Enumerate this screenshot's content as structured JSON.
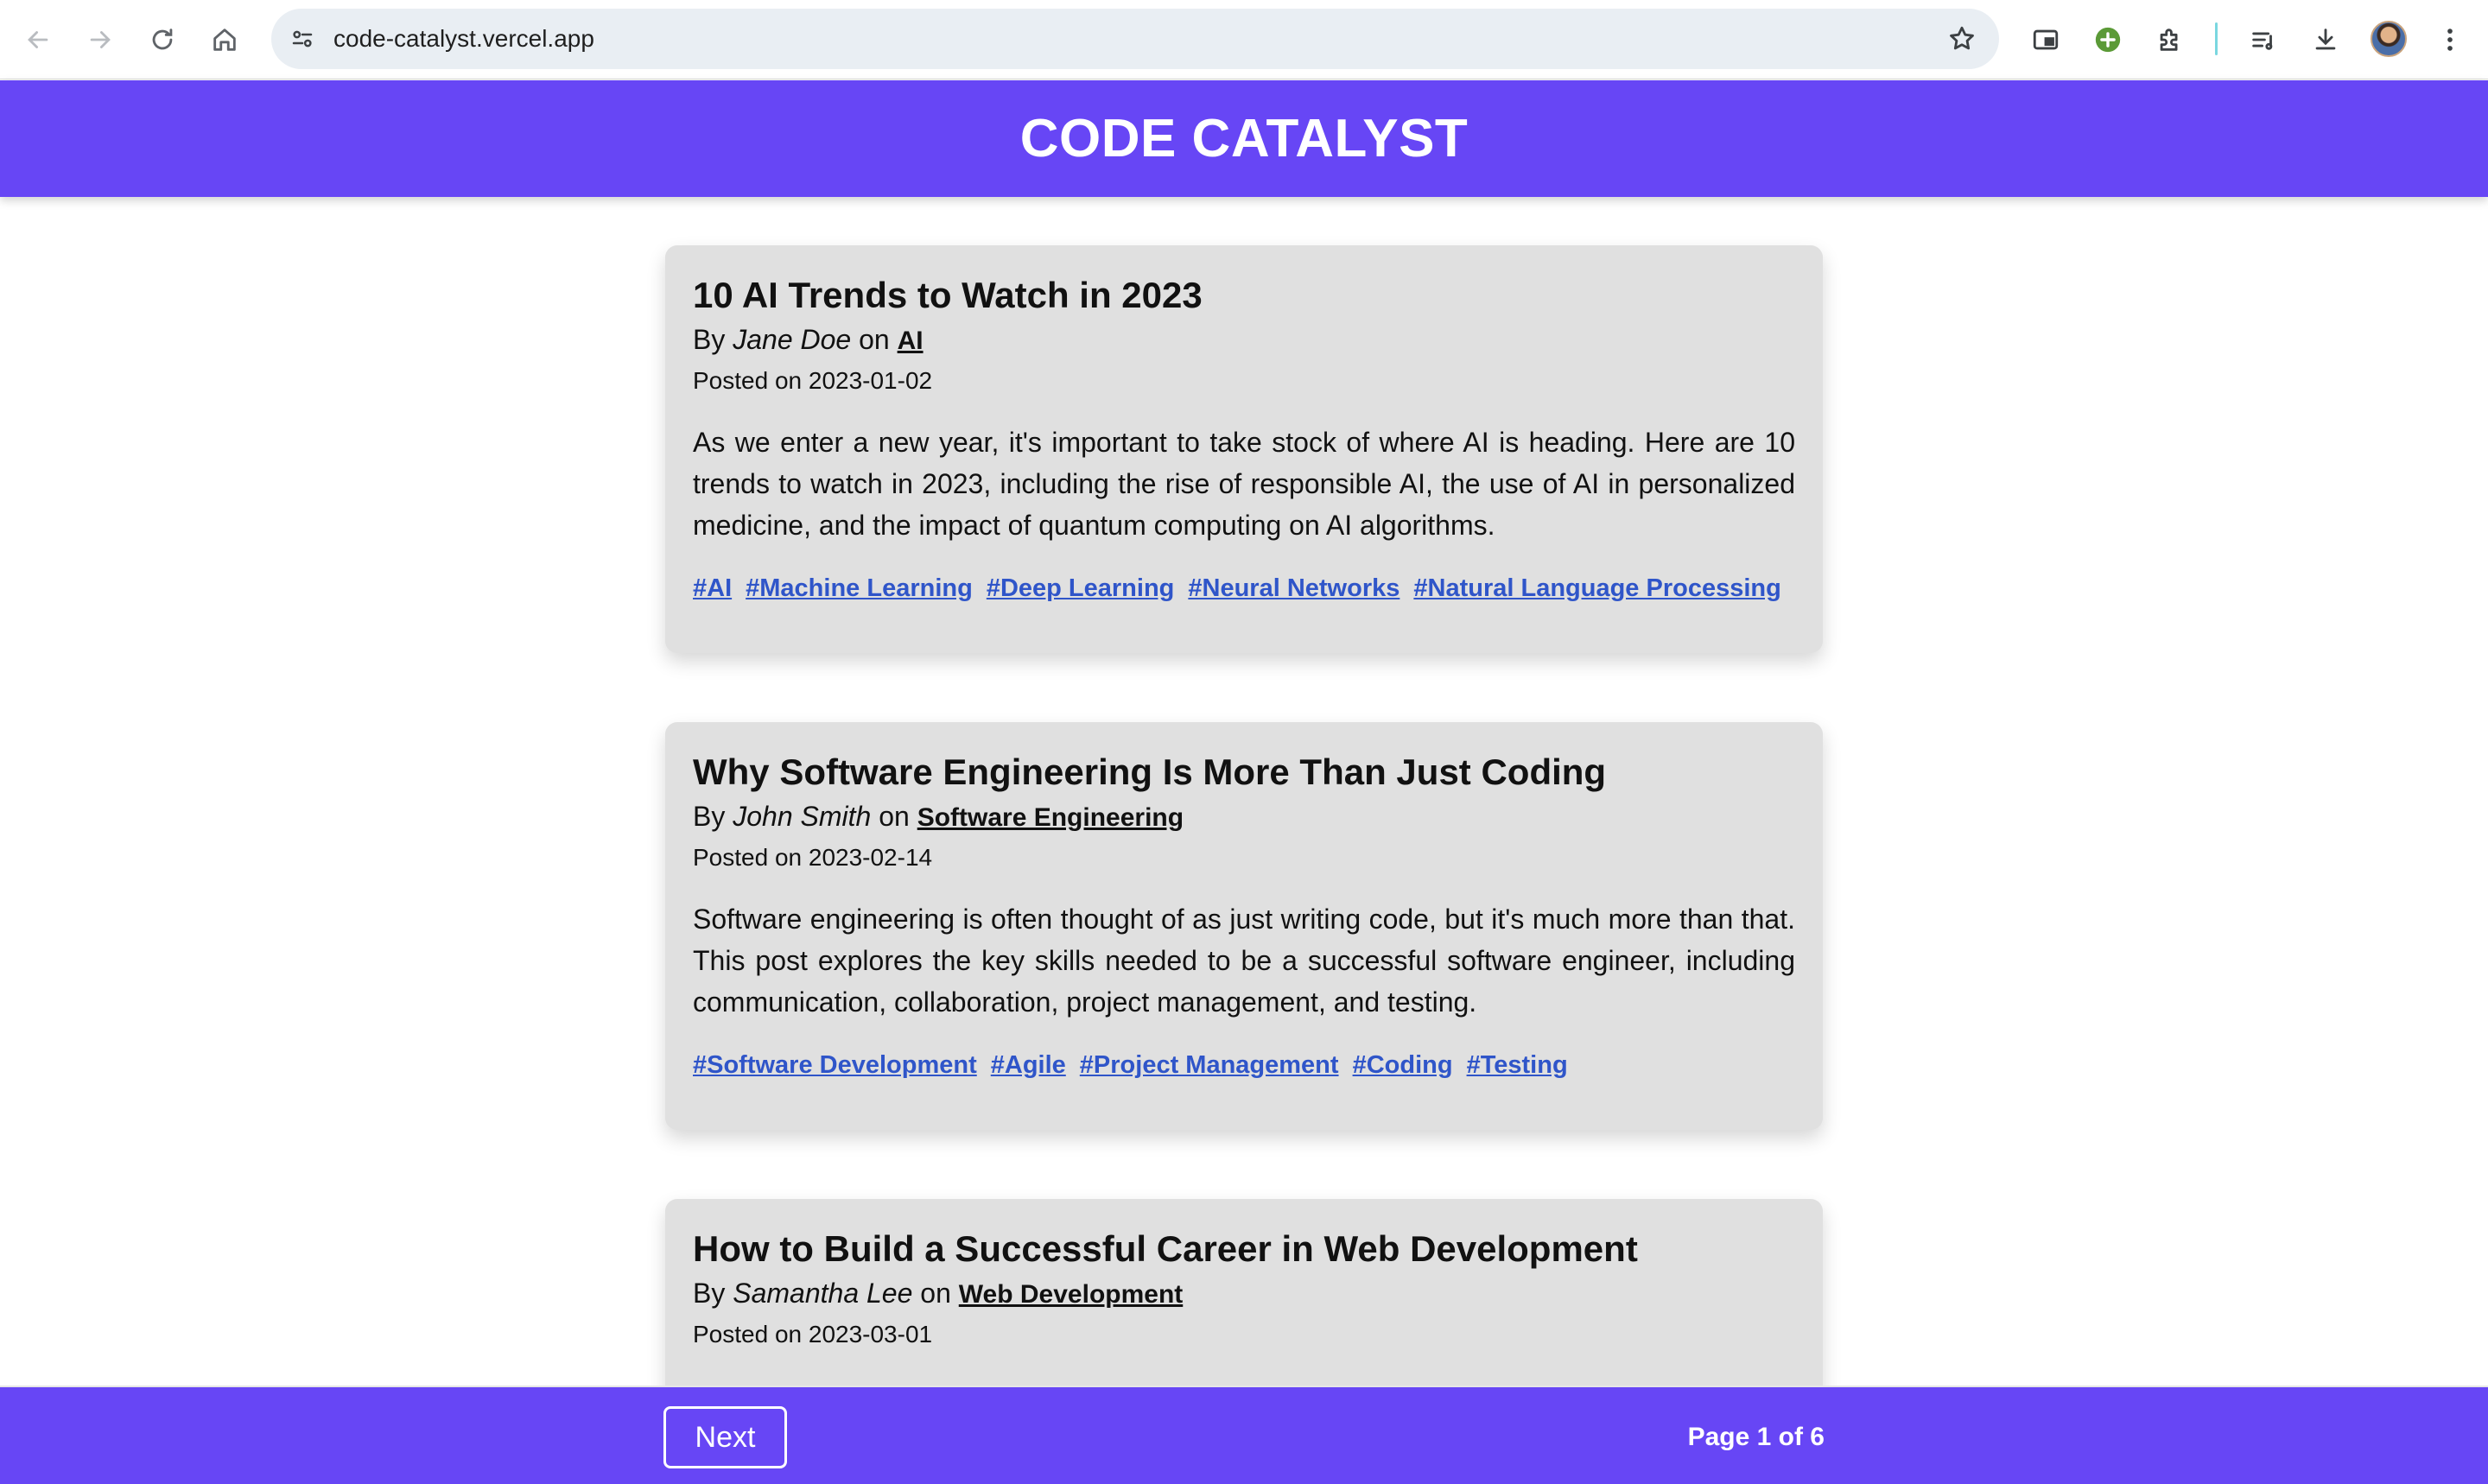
{
  "browser": {
    "url": "code-catalyst.vercel.app",
    "accent_profile_color": "#4a6ea8"
  },
  "header": {
    "title": "CODE CATALYST",
    "color": "#6746f5"
  },
  "posts": [
    {
      "title": "10 AI Trends to Watch in 2023",
      "by": "By",
      "author": "Jane Doe",
      "on": "on",
      "category": "AI",
      "date": "Posted on 2023-01-02",
      "excerpt": "As we enter a new year, it's important to take stock of where AI is heading. Here are 10 trends to watch in 2023, including the rise of responsible AI, the use of AI in personalized medicine, and the impact of quantum computing on AI algorithms.",
      "tags": [
        "#AI",
        "#Machine Learning",
        "#Deep Learning",
        "#Neural Networks",
        "#Natural Language Processing"
      ]
    },
    {
      "title": "Why Software Engineering Is More Than Just Coding",
      "by": "By",
      "author": "John Smith",
      "on": "on",
      "category": "Software Engineering",
      "date": "Posted on 2023-02-14",
      "excerpt": "Software engineering is often thought of as just writing code, but it's much more than that. This post explores the key skills needed to be a successful software engineer, including communication, collaboration, project management, and testing.",
      "tags": [
        "#Software Development",
        "#Agile",
        "#Project Management",
        "#Coding",
        "#Testing"
      ]
    },
    {
      "title": "How to Build a Successful Career in Web Development",
      "by": "By",
      "author": "Samantha Lee",
      "on": "on",
      "category": "Web Development",
      "date": "Posted on 2023-03-01",
      "excerpt": "",
      "tags": []
    }
  ],
  "footer": {
    "next_label": "Next",
    "page_indicator": "Page 1 of 6"
  }
}
